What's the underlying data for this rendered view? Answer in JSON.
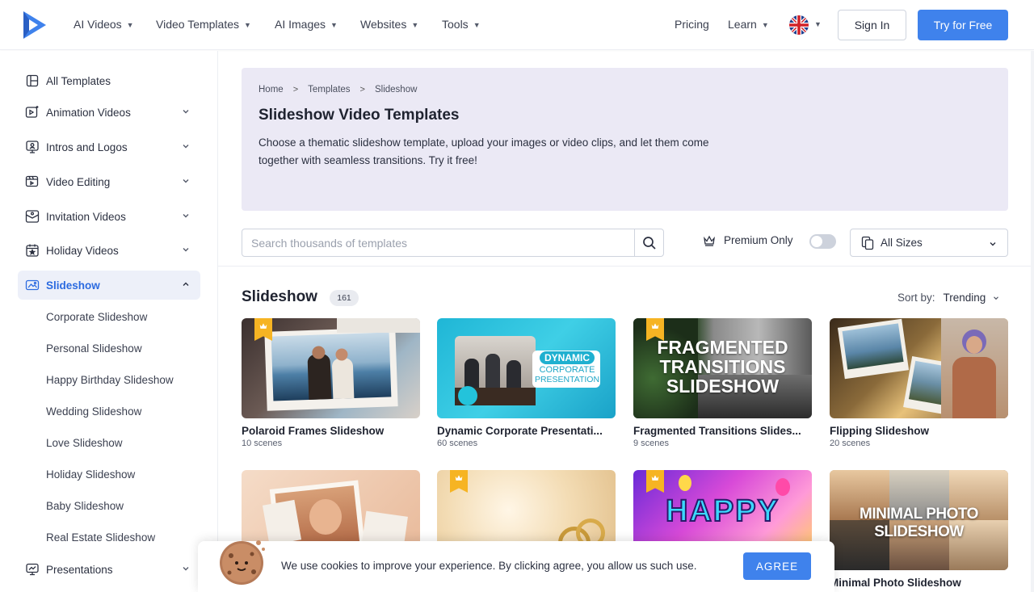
{
  "header": {
    "nav": [
      {
        "label": "AI Videos"
      },
      {
        "label": "Video Templates"
      },
      {
        "label": "AI Images"
      },
      {
        "label": "Websites"
      },
      {
        "label": "Tools"
      }
    ],
    "pricing": "Pricing",
    "learn": "Learn",
    "sign_in": "Sign In",
    "try_free": "Try for Free",
    "brand_color": "#3f82ec"
  },
  "sidebar": {
    "items": [
      {
        "label": "All Templates",
        "icon": "grid-icon"
      },
      {
        "label": "Animation Videos",
        "icon": "animation-icon"
      },
      {
        "label": "Intros and Logos",
        "icon": "monitor-icon"
      },
      {
        "label": "Video Editing",
        "icon": "video-edit-icon"
      },
      {
        "label": "Invitation Videos",
        "icon": "invitation-icon"
      },
      {
        "label": "Holiday Videos",
        "icon": "calendar-star-icon"
      },
      {
        "label": "Slideshow",
        "icon": "slideshow-icon"
      },
      {
        "label": "Presentations",
        "icon": "presentation-icon"
      }
    ],
    "sub_items": [
      "Corporate Slideshow",
      "Personal Slideshow",
      "Happy Birthday Slideshow",
      "Wedding Slideshow",
      "Love Slideshow",
      "Holiday Slideshow",
      "Baby Slideshow",
      "Real Estate Slideshow"
    ],
    "active_color": "#2c6be0"
  },
  "hero": {
    "breadcrumbs": [
      "Home",
      "Templates",
      "Slideshow"
    ],
    "title": "Slideshow Video Templates",
    "description": "Choose a thematic slideshow template, upload your images or video clips, and let them come together with seamless transitions. Try it free!"
  },
  "filters": {
    "search_placeholder": "Search thousands of templates",
    "premium_label": "Premium Only",
    "premium_on": false,
    "sizes_label": "All Sizes"
  },
  "section": {
    "title": "Slideshow",
    "count": "161",
    "sort_label": "Sort by:",
    "sort_value": "Trending"
  },
  "cards": [
    {
      "title": "Polaroid Frames Slideshow",
      "scenes": "10 scenes",
      "premium": true
    },
    {
      "title": "Dynamic Corporate Presentati...",
      "scenes": "60 scenes",
      "premium": false,
      "overlay": [
        "DYNAMIC",
        "CORPORATE",
        "PRESENTATION"
      ]
    },
    {
      "title": "Fragmented Transitions Slides...",
      "scenes": "9 scenes",
      "premium": true,
      "overlay": [
        "FRAGMENTED",
        "TRANSITIONS",
        "SLIDESHOW"
      ]
    },
    {
      "title": "Flipping Slideshow",
      "scenes": "20 scenes",
      "premium": false
    },
    {
      "title": "",
      "scenes": "",
      "premium": false
    },
    {
      "title": "",
      "scenes": "",
      "premium": true
    },
    {
      "title": "",
      "scenes": "",
      "premium": true,
      "overlay": [
        "HAPPY"
      ]
    },
    {
      "title": "Minimal Photo Slideshow",
      "scenes": "",
      "premium": false,
      "overlay": [
        "MINIMAL PHOTO SLIDESHOW"
      ]
    }
  ],
  "cookie": {
    "text": "We use cookies to improve your experience. By clicking agree, you allow us such use.",
    "agree": "AGREE"
  }
}
